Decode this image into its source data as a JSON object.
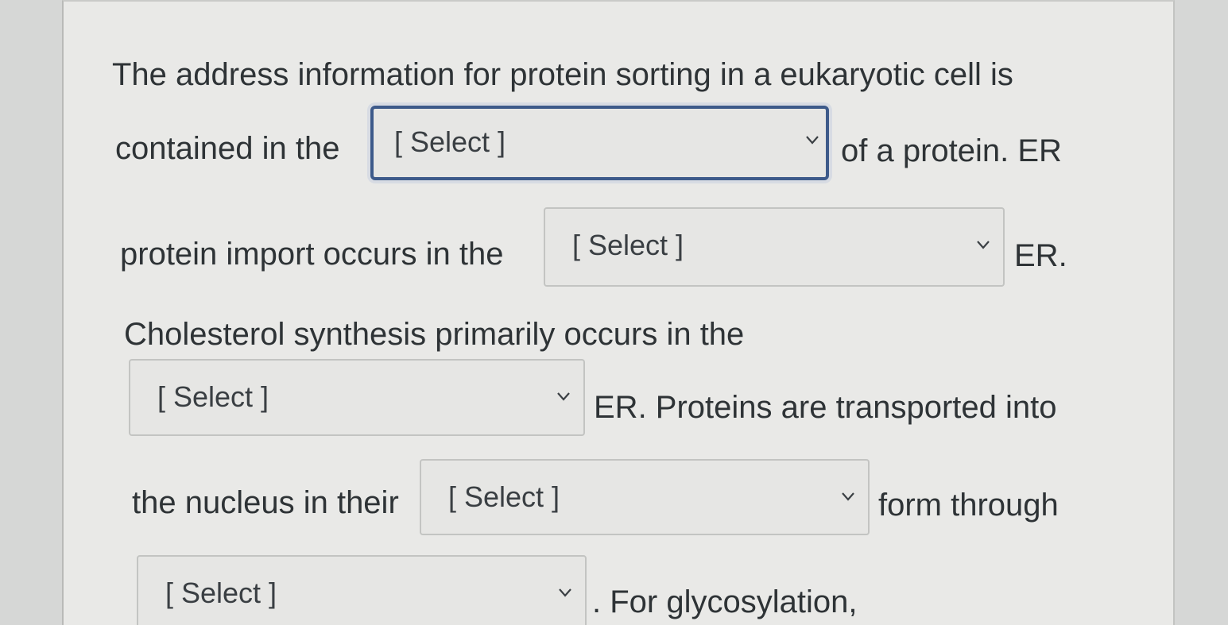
{
  "question": {
    "line1": "The address information for protein sorting in a eukaryotic cell is",
    "line2_pre": "contained in the",
    "line2_post": "of a protein. ER",
    "line3_pre": "protein import occurs in the",
    "line3_post": "ER.",
    "line4": "Cholesterol synthesis primarily occurs in the",
    "line5_post": "ER.  Proteins are transported into",
    "line6_pre": "the nucleus in their",
    "line6_post": "form through",
    "line7_post": ".  For glycosylation,"
  },
  "dropdowns": [
    {
      "value": "[ Select ]",
      "focused": true
    },
    {
      "value": "[ Select ]",
      "focused": false
    },
    {
      "value": "[ Select ]",
      "focused": false
    },
    {
      "value": "[ Select ]",
      "focused": false
    },
    {
      "value": "[ Select ]",
      "focused": false
    }
  ],
  "icons": {
    "dropdown": "chevron-down-icon"
  }
}
